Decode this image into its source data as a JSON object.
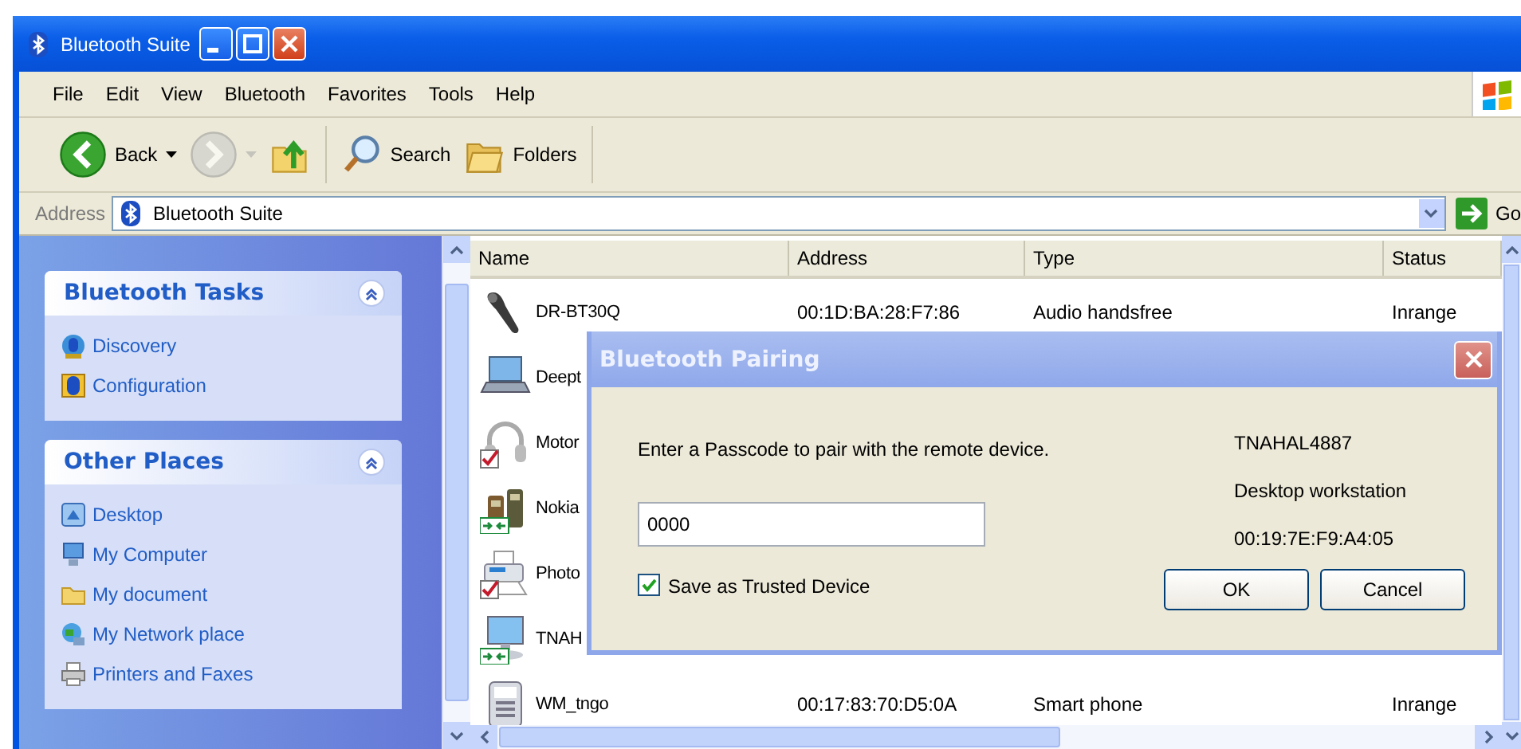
{
  "window": {
    "title": "Bluetooth Suite"
  },
  "menu": [
    {
      "label": "File"
    },
    {
      "label": "Edit"
    },
    {
      "label": "View"
    },
    {
      "label": "Bluetooth"
    },
    {
      "label": "Favorites"
    },
    {
      "label": "Tools"
    },
    {
      "label": "Help"
    }
  ],
  "toolbar": [
    {
      "kind": "back",
      "label": "Back",
      "disabled": false
    },
    {
      "kind": "forward",
      "disabled": true
    },
    {
      "kind": "up",
      "disabled": false
    },
    {
      "kind": "search",
      "label": "Search",
      "disabled": false
    },
    {
      "kind": "folders",
      "label": "Folders",
      "disabled": false
    }
  ],
  "address": {
    "label": "Address",
    "value": "Bluetooth Suite",
    "go": "Go"
  },
  "sidebar": [
    {
      "title": "Bluetooth Tasks",
      "expanded": true,
      "items": [
        {
          "kind": "discovery",
          "label": "Discovery"
        },
        {
          "kind": "configuration",
          "label": "Configuration"
        }
      ]
    },
    {
      "title": "Other Places",
      "expanded": true,
      "items": [
        {
          "kind": "desktop",
          "label": "Desktop"
        },
        {
          "kind": "computer",
          "label": "My Computer"
        },
        {
          "kind": "folder",
          "label": "My document"
        },
        {
          "kind": "network",
          "label": "My Network place"
        },
        {
          "kind": "printer",
          "label": "Printers and Faxes"
        }
      ]
    }
  ],
  "list": {
    "columns": [
      "Name",
      "Address",
      "Type",
      "Status"
    ],
    "rows": [
      {
        "kind": "headset",
        "name": "DR-BT30Q",
        "address": "00:1D:BA:28:F7:86",
        "type": "Audio handsfree",
        "status": "Inrange",
        "trusted": false,
        "connected": false
      },
      {
        "kind": "laptop",
        "name": "Deept",
        "trusted": false,
        "connected": false
      },
      {
        "kind": "headphones",
        "name": "Motor",
        "trusted": true,
        "connected": false
      },
      {
        "kind": "phones",
        "name": "Nokia",
        "trusted": false,
        "connected": true
      },
      {
        "kind": "printer",
        "name": "Photo",
        "trusted": true,
        "connected": false
      },
      {
        "kind": "desktop",
        "name": "TNAH",
        "trusted": false,
        "connected": true
      },
      {
        "kind": "smartphone",
        "name": "WM_tngo",
        "address": "00:17:83:70:D5:0A",
        "type": "Smart phone",
        "status": "Inrange",
        "trusted": false,
        "connected": false
      }
    ]
  },
  "dialog": {
    "title": "Bluetooth Pairing",
    "prompt": "Enter a Passcode to pair with the remote device.",
    "passcode": "0000",
    "save_trusted": {
      "label": "Save as Trusted Device",
      "checked": true
    },
    "device": [
      "TNAHAL4887",
      "Desktop workstation",
      "00:19:7E:F9:A4:05"
    ],
    "buttons": [
      "OK",
      "Cancel"
    ]
  }
}
